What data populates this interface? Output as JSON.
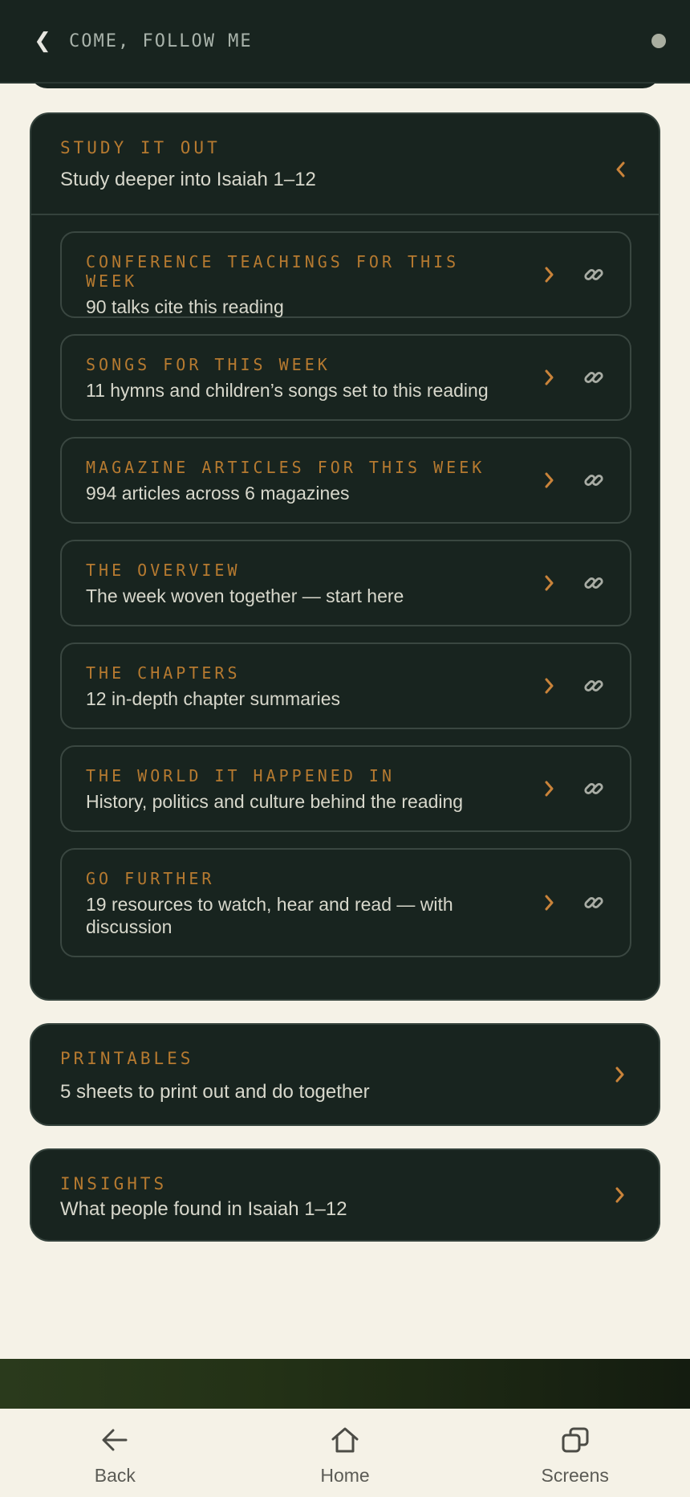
{
  "header": {
    "back_glyph": "❮",
    "title": "COME, FOLLOW ME"
  },
  "study": {
    "kicker": "STUDY IT OUT",
    "subtitle": "Study deeper into Isaiah 1–12",
    "items": [
      {
        "kicker": "CONFERENCE TEACHINGS FOR THIS WEEK",
        "subtitle": "90 talks cite this reading"
      },
      {
        "kicker": "SONGS FOR THIS WEEK",
        "subtitle": "11 hymns and children’s songs set to this reading"
      },
      {
        "kicker": "MAGAZINE ARTICLES FOR THIS WEEK",
        "subtitle": "994 articles across 6 magazines"
      },
      {
        "kicker": "THE OVERVIEW",
        "subtitle": "The week woven together — start here"
      },
      {
        "kicker": "THE CHAPTERS",
        "subtitle": "12 in-depth chapter summaries"
      },
      {
        "kicker": "THE WORLD IT HAPPENED IN",
        "subtitle": "History, politics and culture behind the reading"
      },
      {
        "kicker": "GO FURTHER",
        "subtitle": "19 resources to watch, hear and read — with discussion"
      }
    ]
  },
  "printables": {
    "kicker": "PRINTABLES",
    "subtitle": "5 sheets to print out and do together"
  },
  "insights": {
    "kicker": "INSIGHTS",
    "subtitle": "What people found in Isaiah 1–12"
  },
  "nav": {
    "back": "Back",
    "home": "Home",
    "screens": "Screens"
  },
  "colors": {
    "panel": "#18241f",
    "accent": "#b67a30",
    "page": "#f5f2e7"
  }
}
